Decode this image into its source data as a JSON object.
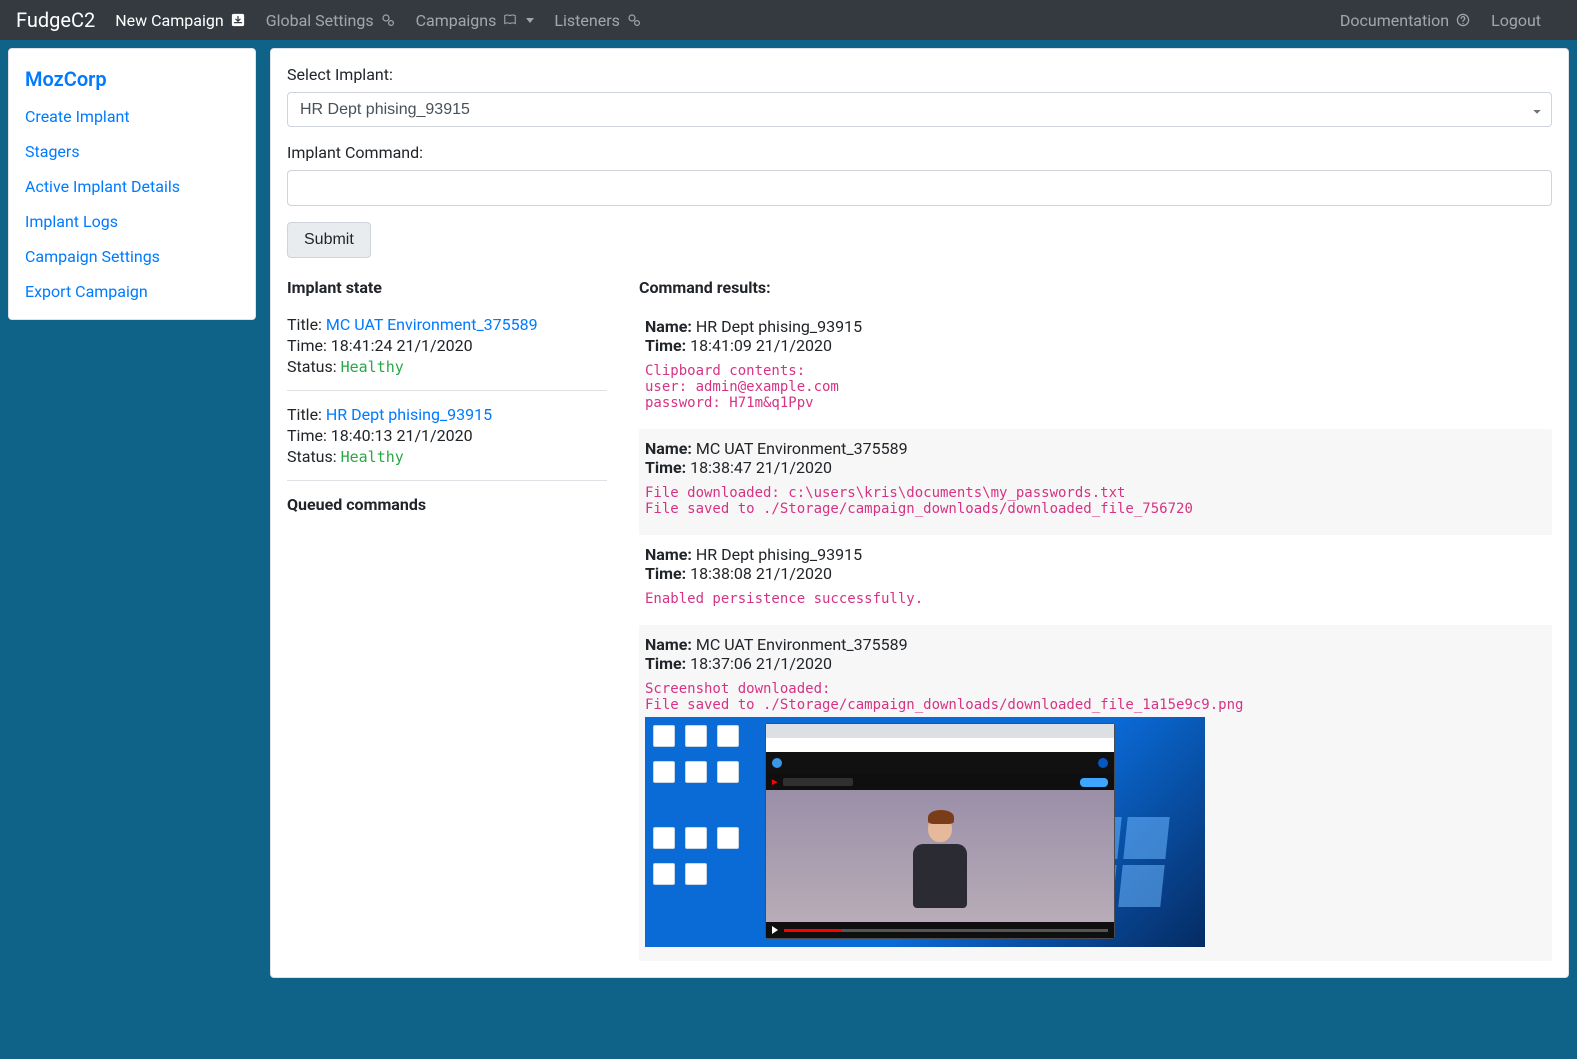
{
  "nav": {
    "brand": "FudgeC2",
    "new_campaign": "New Campaign",
    "global_settings": "Global Settings",
    "campaigns": "Campaigns",
    "listeners": "Listeners",
    "documentation": "Documentation",
    "logout": "Logout"
  },
  "sidebar": {
    "title": "MozCorp",
    "items": [
      "Create Implant",
      "Stagers",
      "Active Implant Details",
      "Implant Logs",
      "Campaign Settings",
      "Export Campaign"
    ]
  },
  "form": {
    "select_label": "Select Implant:",
    "select_value": "HR Dept phising_93915",
    "command_label": "Implant Command:",
    "command_value": "",
    "submit_label": "Submit"
  },
  "state_heading": "Implant state",
  "queued_heading": "Queued commands",
  "results_heading": "Command results:",
  "labels": {
    "title": "Title: ",
    "time": "Time: ",
    "status": "Status: ",
    "name": "Name: ",
    "rtime": "Time: "
  },
  "implants": [
    {
      "title": "MC UAT Environment_375589",
      "time": "18:41:24 21/1/2020",
      "status": "Healthy"
    },
    {
      "title": "HR Dept phising_93915",
      "time": "18:40:13 21/1/2020",
      "status": "Healthy"
    }
  ],
  "results": [
    {
      "name": "HR Dept phising_93915",
      "time": "18:41:09 21/1/2020",
      "output": "Clipboard contents:\nuser: admin@example.com\npassword: H71m&q1Ppv",
      "alt": false,
      "has_image": false
    },
    {
      "name": "MC UAT Environment_375589",
      "time": "18:38:47 21/1/2020",
      "output": "File downloaded: c:\\users\\kris\\documents\\my_passwords.txt\nFile saved to ./Storage/campaign_downloads/downloaded_file_756720",
      "alt": true,
      "has_image": false
    },
    {
      "name": "HR Dept phising_93915",
      "time": "18:38:08 21/1/2020",
      "output": "Enabled persistence successfully.",
      "alt": false,
      "has_image": false
    },
    {
      "name": "MC UAT Environment_375589",
      "time": "18:37:06 21/1/2020",
      "output": "Screenshot downloaded:\nFile saved to ./Storage/campaign_downloads/downloaded_file_1a15e9c9.png",
      "alt": true,
      "has_image": true
    }
  ]
}
